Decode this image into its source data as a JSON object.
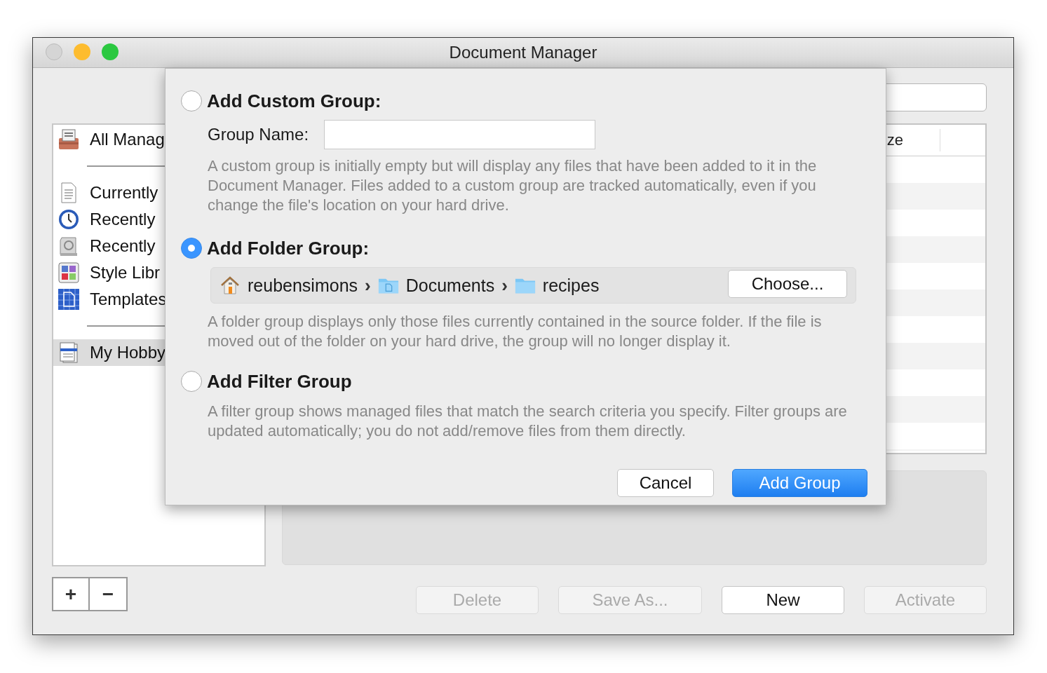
{
  "window": {
    "title": "Document Manager"
  },
  "sidebar": {
    "sections": [
      [
        {
          "label": "All Manag",
          "kind": "tray",
          "selected": false
        }
      ],
      [
        {
          "label": "Currently",
          "kind": "document",
          "selected": false
        },
        {
          "label": "Recently",
          "kind": "clock",
          "selected": false
        },
        {
          "label": "Recently",
          "kind": "disk",
          "selected": false
        },
        {
          "label": "Style Libr",
          "kind": "palette",
          "selected": false
        },
        {
          "label": "Templates",
          "kind": "blueprint",
          "selected": false
        }
      ],
      [
        {
          "label": "My Hobby",
          "kind": "group",
          "selected": true
        }
      ]
    ]
  },
  "list_buttons": [
    "+",
    "−"
  ],
  "table": {
    "columns": [
      {
        "label": "ze"
      }
    ]
  },
  "buttons": [
    {
      "label": "Delete",
      "disabled": true
    },
    {
      "label": "Save As...",
      "disabled": true
    },
    {
      "label": "New",
      "disabled": false
    },
    {
      "label": "Activate",
      "disabled": true
    }
  ],
  "sheet": {
    "options": [
      {
        "kind": "custom",
        "title": "Add Custom Group:",
        "selected": false,
        "field_label": "Group Name:",
        "description": "A custom group is initially empty but will display any files that have been added to it in the Document Manager. Files added to a custom group are tracked automatically, even if you change the file's location on your hard drive."
      },
      {
        "kind": "folder",
        "title": "Add Folder Group:",
        "selected": true,
        "path": [
          {
            "kind": "home",
            "label": "reubensimons"
          },
          {
            "kind": "documents",
            "separator": "›",
            "label": "Documents"
          },
          {
            "kind": "folder",
            "separator": "›",
            "label": "recipes"
          }
        ],
        "choose_button": "Choose...",
        "description": "A folder group displays only those files currently contained in the source folder. If the file is moved out of the folder on your hard drive, the group will no longer display it."
      },
      {
        "kind": "filter",
        "title": "Add Filter Group",
        "selected": false,
        "description": "A filter group shows managed files that match the search criteria you specify. Filter groups are updated automatically; you do not add/remove files from them directly."
      }
    ],
    "buttons": [
      {
        "label": "Cancel",
        "default": false
      },
      {
        "label": "Add Group",
        "default": true
      }
    ]
  }
}
